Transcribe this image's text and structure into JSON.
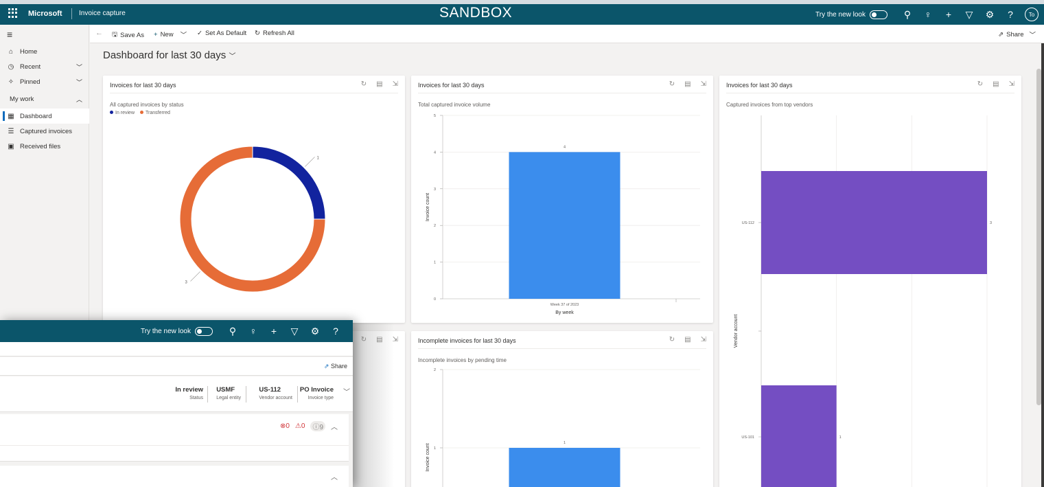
{
  "topbar": {
    "brand": "Microsoft",
    "app_name": "Invoice capture",
    "environment": "SANDBOX",
    "try_new_look": "Try the new look",
    "avatar_initials": "To",
    "icons": [
      "search-icon",
      "lightbulb-icon",
      "plus-icon",
      "filter-icon",
      "settings-icon",
      "help-icon"
    ]
  },
  "sidebar": {
    "items": [
      {
        "label": "Home",
        "icon": "home-icon"
      },
      {
        "label": "Recent",
        "icon": "clock-icon"
      },
      {
        "label": "Pinned",
        "icon": "pin-icon"
      },
      {
        "label": "My work"
      },
      {
        "label": "Dashboard",
        "icon": "dashboard-icon"
      },
      {
        "label": "Captured invoices",
        "icon": "list-icon"
      },
      {
        "label": "Received files",
        "icon": "files-icon"
      }
    ]
  },
  "commandbar": {
    "save_as": "Save As",
    "new": "New",
    "set_default": "Set As Default",
    "refresh_all": "Refresh All",
    "share": "Share"
  },
  "page": {
    "title": "Dashboard for last 30 days"
  },
  "cards": {
    "status": {
      "title": "Invoices for last 30 days",
      "subtitle": "All captured invoices by status",
      "legend": [
        "In review",
        "Transferred"
      ]
    },
    "volume": {
      "title": "Invoices for last 30 days",
      "subtitle": "Total captured invoice volume"
    },
    "vendors": {
      "title": "Invoices for last 30 days",
      "subtitle": "Captured invoices from top vendors"
    },
    "incomplete": {
      "title": "Incomplete invoices for last 30 days",
      "subtitle": "Incomplete invoices by pending time"
    }
  },
  "colors": {
    "in_review": "#12239e",
    "transferred": "#e66c37",
    "bar_blue": "#3b8ded",
    "bar_purple": "#744ec2",
    "topbar": "#0b556a"
  },
  "chart_data": [
    {
      "type": "pie",
      "subtitle": "All captured invoices by status",
      "labels": [
        "In review",
        "Transferred"
      ],
      "values": [
        1,
        3
      ],
      "donut": true,
      "legend": "top-left"
    },
    {
      "type": "bar",
      "subtitle": "Total captured invoice volume",
      "categories": [
        "Week 37 of 2023"
      ],
      "values": [
        4
      ],
      "xlabel": "By week",
      "ylabel": "Invoice count",
      "ylim": [
        0,
        5
      ],
      "yticks": [
        0,
        1,
        2,
        3,
        4,
        5
      ]
    },
    {
      "type": "bar",
      "orientation": "horizontal",
      "subtitle": "Captured invoices from top vendors",
      "categories": [
        "US-112",
        "US-101"
      ],
      "values": [
        3,
        1
      ],
      "ylabel": "Vendor account"
    },
    {
      "type": "bar",
      "subtitle": "Incomplete invoices by pending time",
      "ylabel": "Invoice count",
      "values": [
        1
      ],
      "yticks": [
        1,
        2
      ]
    }
  ],
  "overlay": {
    "try_new_look": "Try the new look",
    "share": "Share",
    "facts": [
      {
        "value": "In review",
        "key": "Status"
      },
      {
        "value": "USMF",
        "key": "Legal entity"
      },
      {
        "value": "US-112",
        "key": "Vendor account"
      },
      {
        "value": "PO Invoice",
        "key": "Invoice type"
      }
    ],
    "errors": "0",
    "warnings": "0",
    "info": "9"
  }
}
